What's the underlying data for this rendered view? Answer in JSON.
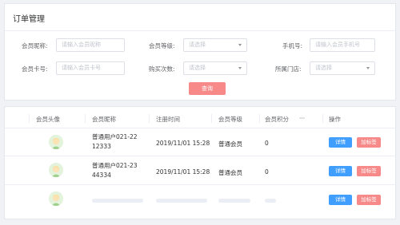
{
  "page": {
    "title": "订单管理"
  },
  "filters": {
    "nickname_label": "会员昵称:",
    "nickname_placeholder": "请输入会员昵称",
    "level_label": "会员等级:",
    "level_placeholder": "请选择",
    "phone_label": "手机号:",
    "phone_placeholder": "请输入会员手机号",
    "card_label": "会员卡号:",
    "card_placeholder": "请输入会员卡号",
    "purchase_label": "购买次数:",
    "purchase_placeholder": "请选择",
    "store_label": "所属门店:",
    "store_placeholder": "请选择",
    "query_label": "查询"
  },
  "table": {
    "headers": {
      "avatar": "会员头像",
      "nickname": "会员昵称",
      "register_time": "注册时间",
      "level": "会员等级",
      "points": "会员积分",
      "more": "···",
      "actions": "操作"
    },
    "rows": [
      {
        "nickname_line1": "普通用户021-22",
        "nickname_line2": "12333",
        "register_time": "2019/11/01 15:28",
        "level": "普通会员",
        "points": "0",
        "detail": "详情",
        "tag": "加标签"
      },
      {
        "nickname_line1": "普通用户021-23",
        "nickname_line2": "44334",
        "register_time": "2019/11/01 15:28",
        "level": "普通会员",
        "points": "0",
        "detail": "详情",
        "tag": "加标签"
      },
      {
        "detail": "详情",
        "tag": "加标签"
      }
    ]
  },
  "colors": {
    "primary": "#409eff",
    "danger": "#f78989",
    "border": "#dcdfe6"
  },
  "icons": {
    "avatar": "user-avatar-icon",
    "select": "chevron-down-icon"
  }
}
